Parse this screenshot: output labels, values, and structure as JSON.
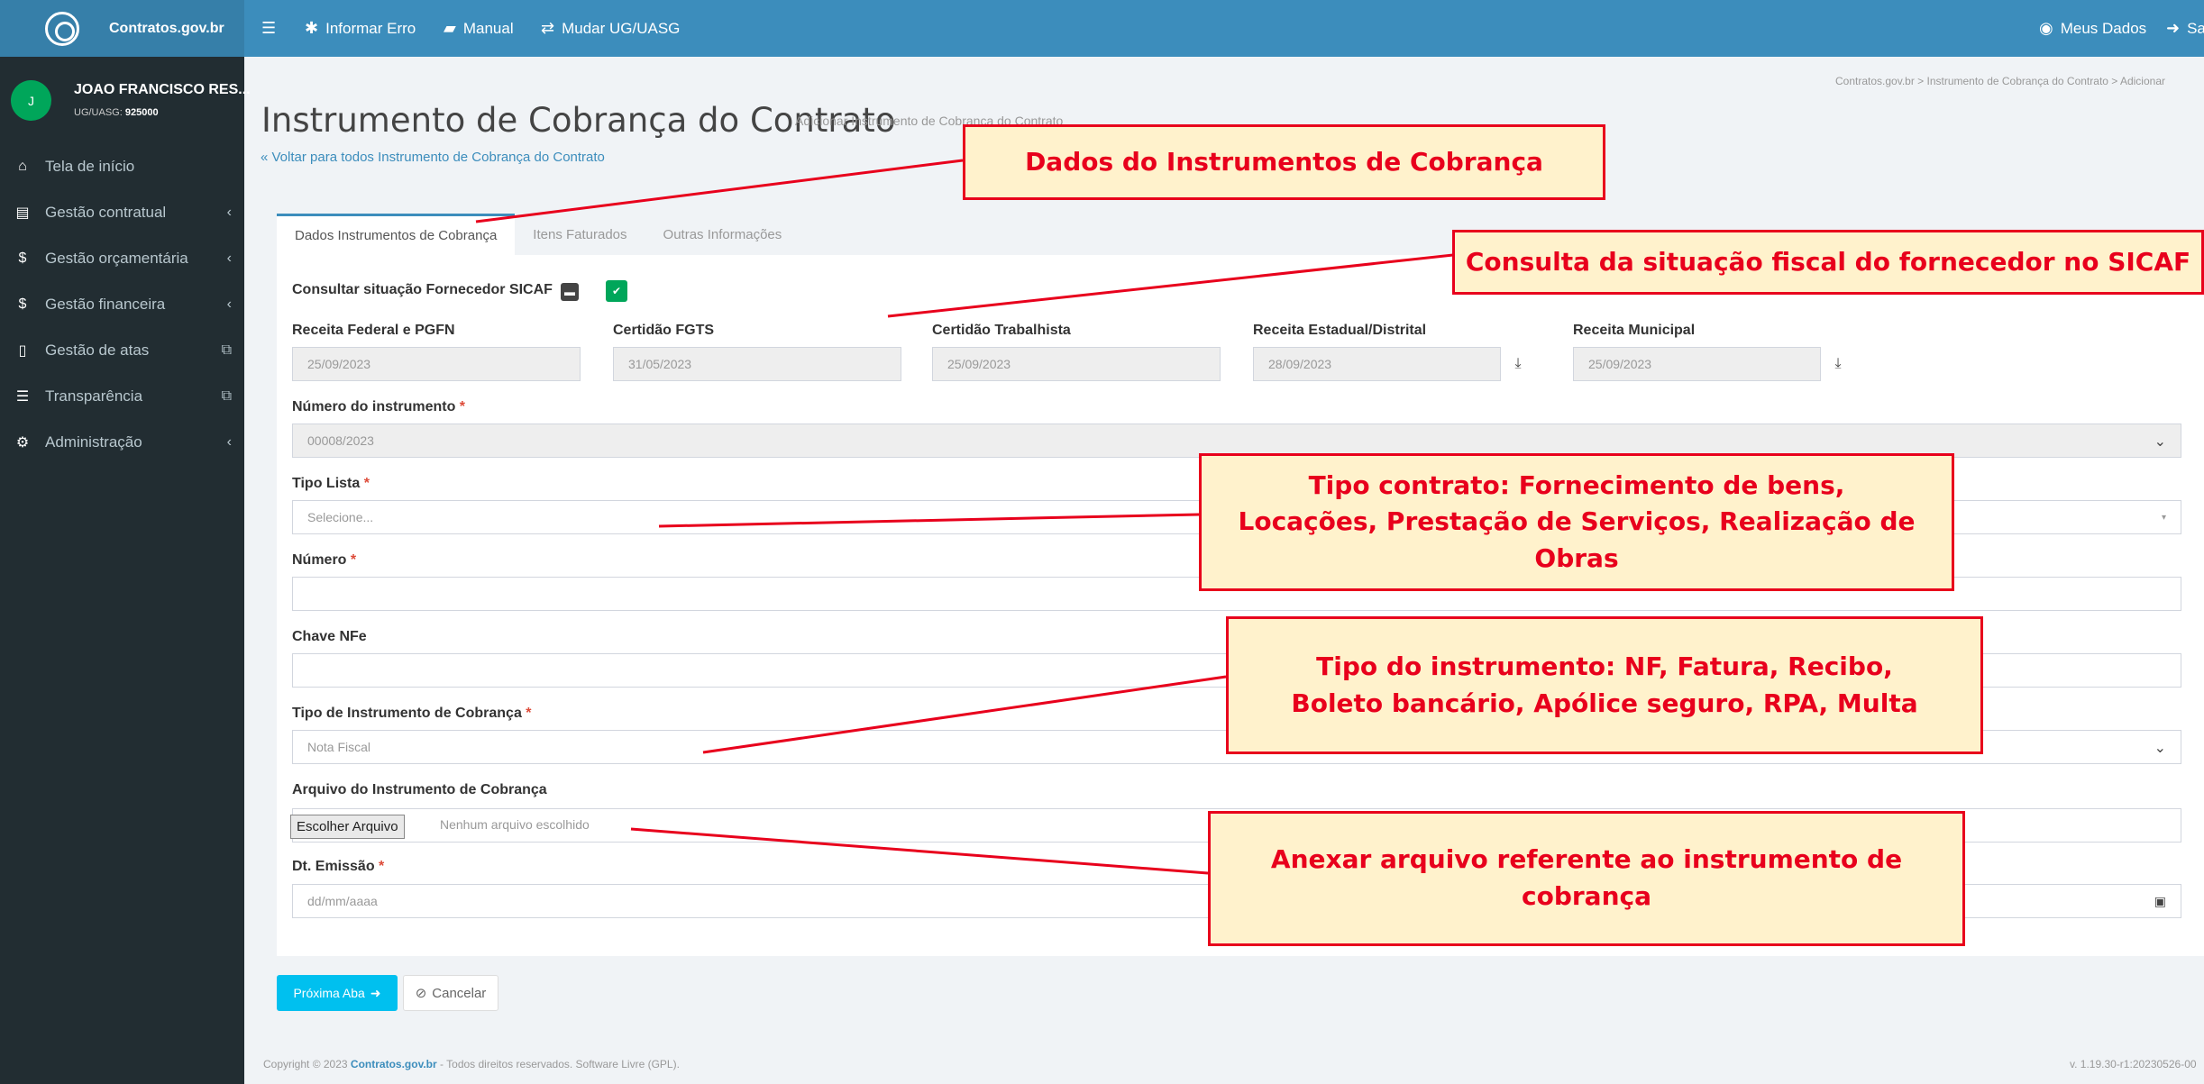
{
  "topbar": {
    "brand": "Contratos.gov.br",
    "menu_icon": "hamburger-icon",
    "report_error": "Informar Erro",
    "manual": "Manual",
    "change_ug": "Mudar UG/UASG",
    "my_data": "Meus Dados",
    "logout": "Sa"
  },
  "sidebar": {
    "avatar_letter": "J",
    "user_name": "JOAO FRANCISCO RES...",
    "ug_label": "UG/UASG:",
    "ug_value": "925000",
    "items": [
      {
        "label": "Tela de início",
        "icon": "home-icon"
      },
      {
        "label": "Gestão contratual",
        "icon": "document-icon",
        "right": "‹"
      },
      {
        "label": "Gestão orçamentária",
        "icon": "dollar-icon",
        "right": "‹"
      },
      {
        "label": "Gestão financeira",
        "icon": "dollar-icon",
        "right": "‹"
      },
      {
        "label": "Gestão de atas",
        "icon": "file-icon",
        "right": "⧉"
      },
      {
        "label": "Transparência",
        "icon": "list-icon",
        "right": "⧉"
      },
      {
        "label": "Administração",
        "icon": "gears-icon",
        "right": "‹"
      }
    ]
  },
  "header": {
    "title": "Instrumento de Cobrança do Contrato",
    "subtitle": "Adicionar Instrumento de Cobrança do Contrato",
    "breadcrumb": "Contratos.gov.br  >  Instrumento de Cobrança do Contrato  >  Adicionar",
    "back_link": "« Voltar para todos Instrumento de Cobrança do Contrato"
  },
  "tabs": [
    "Dados Instrumentos de Cobrança",
    "Itens Faturados",
    "Outras Informações"
  ],
  "form": {
    "sicaf_label": "Consultar situação Fornecedor SICAF",
    "certificates": [
      {
        "label": "Receita Federal e PGFN",
        "value": "25/09/2023"
      },
      {
        "label": "Certidão FGTS",
        "value": "31/05/2023"
      },
      {
        "label": "Certidão Trabalhista",
        "value": "25/09/2023"
      },
      {
        "label": "Receita Estadual/Distrital",
        "value": "28/09/2023"
      },
      {
        "label": "Receita Municipal",
        "value": "25/09/2023"
      }
    ],
    "numero_instrumento_label": "Número do instrumento",
    "numero_instrumento_value": "00008/2023",
    "tipo_lista_label": "Tipo Lista",
    "tipo_lista_placeholder": "Selecione...",
    "numero_label": "Número",
    "chave_label": "Chave NFe",
    "tipo_instrumento_label": "Tipo de Instrumento de Cobrança",
    "tipo_instrumento_value": "Nota Fiscal",
    "arquivo_label": "Arquivo do Instrumento de Cobrança",
    "file_button": "Escolher Arquivo",
    "file_none": "Nenhum arquivo escolhido",
    "dt_emissao_label": "Dt. Emissão",
    "dt_emissao_placeholder": "dd/mm/aaaa",
    "required_mark": "*"
  },
  "buttons": {
    "next": "Próxima Aba",
    "cancel": "Cancelar"
  },
  "footer": {
    "copyright_prefix": "Copyright © 2023",
    "copyright_brand": "Contratos.gov.br",
    "copyright_suffix": "- Todos direitos reservados. Software Livre (GPL).",
    "version": "v. 1.19.30-r1:20230526-00"
  },
  "annotations": {
    "dados": "Dados do Instrumentos de Cobrança",
    "sicaf": "Consulta da situação fiscal do fornecedor no SICAF",
    "tipo_contrato": "Tipo contrato: Fornecimento de bens, Locações, Prestação de Serviços, Realização de Obras",
    "tipo_instrumento": "Tipo do instrumento: NF, Fatura, Recibo, Boleto bancário, Apólice seguro, RPA, Multa",
    "anexar": "Anexar arquivo referente ao instrumento de cobrança"
  },
  "colors": {
    "topbar": "#3c8dbc",
    "sidebar": "#222d32",
    "accent": "#00c0ef",
    "annotation_border": "#e8001c",
    "annotation_fill": "#fff2cc"
  }
}
